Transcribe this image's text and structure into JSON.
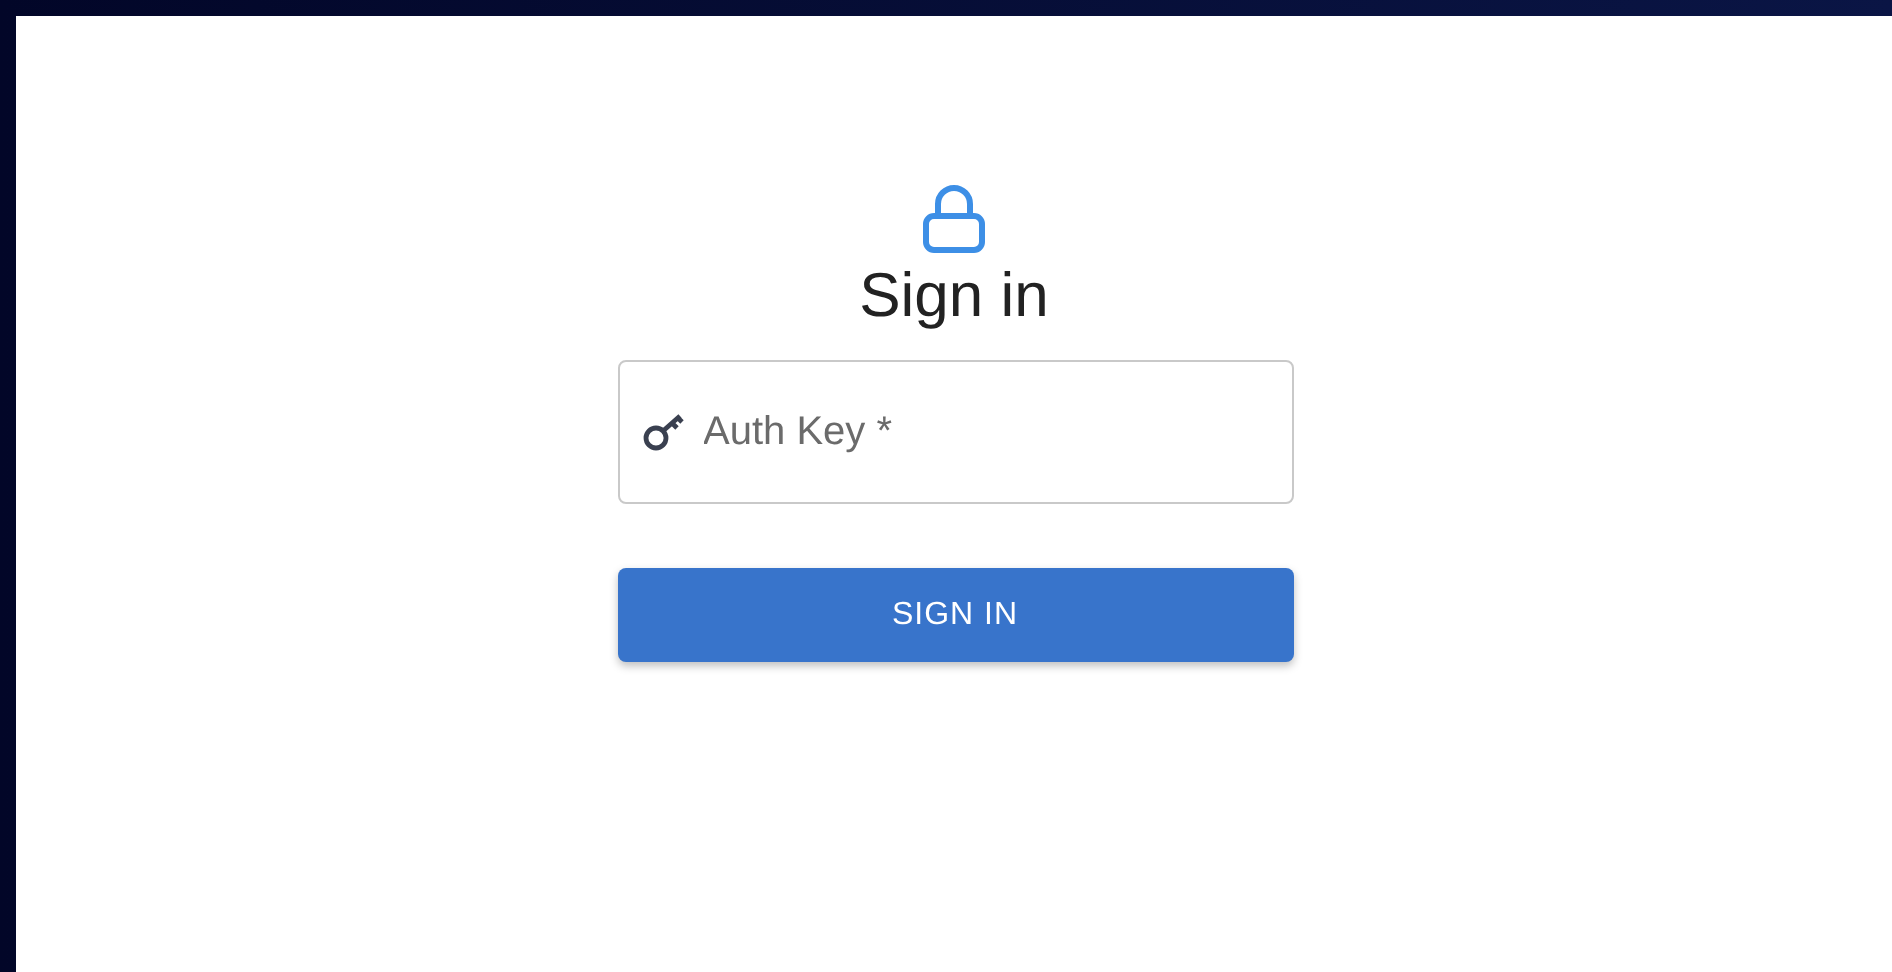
{
  "title": "Sign in",
  "auth_key_field": {
    "placeholder": "Auth Key *"
  },
  "sign_in_button": {
    "label": "SIGN IN"
  }
}
